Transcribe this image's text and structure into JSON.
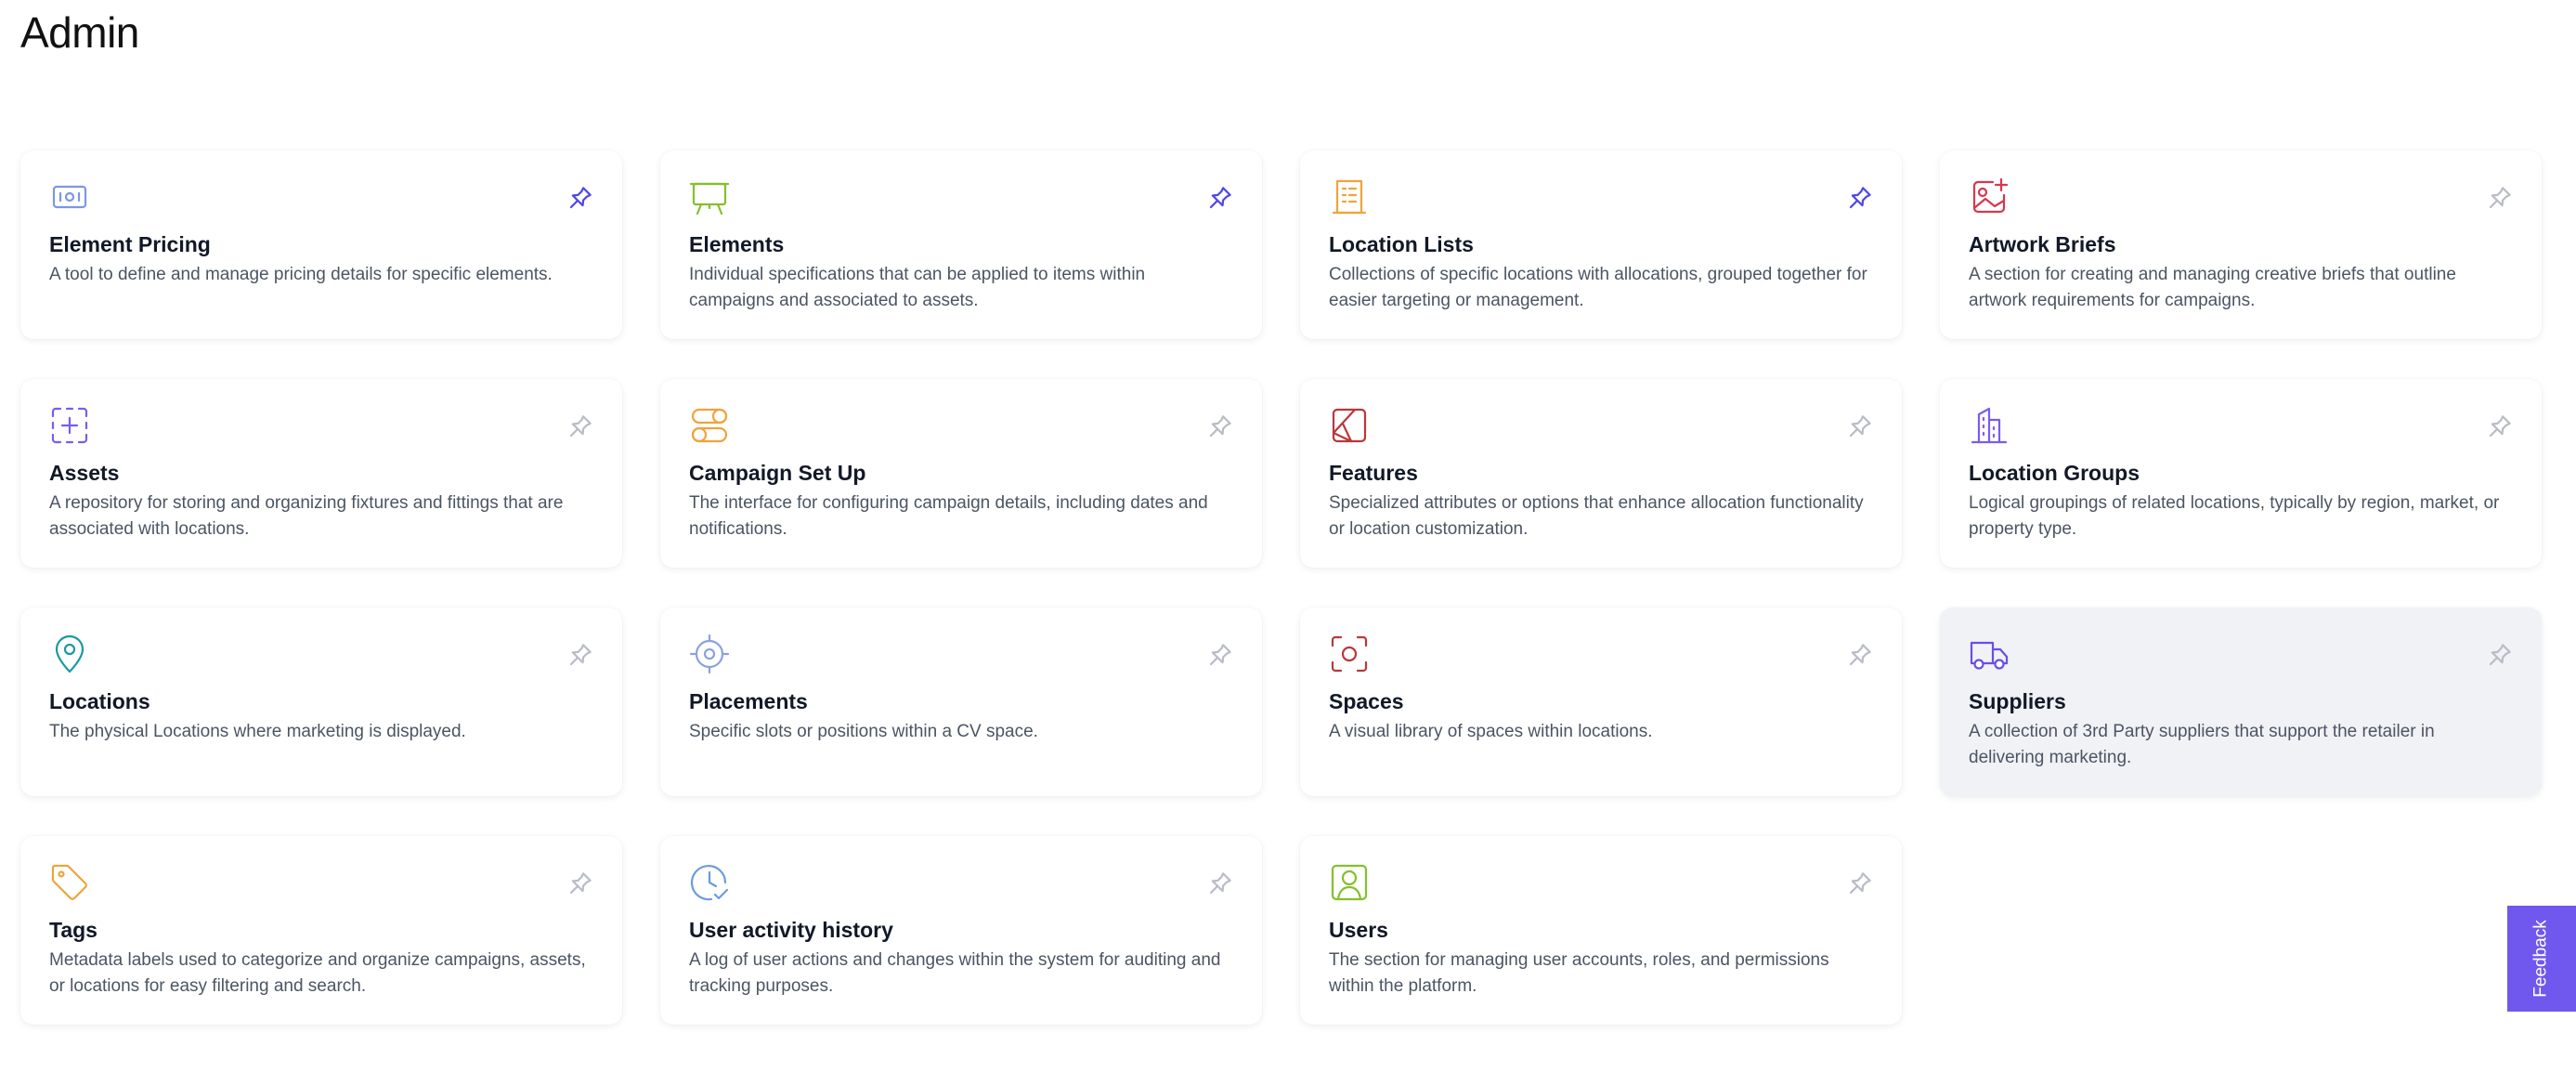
{
  "page": {
    "title": "Admin"
  },
  "colors": {
    "pin_active": "#4f46e5",
    "pin_inactive": "#b8bcc6",
    "hover_card": "#f1f2f6",
    "feedback_bg": "#7057ee"
  },
  "cards": [
    {
      "title": "Element Pricing",
      "description": "A tool to define and manage pricing details for specific elements.",
      "icon": "price-tag-card-icon",
      "icon_color": "#7c96e6",
      "pinned": true
    },
    {
      "title": "Elements",
      "description": "Individual specifications that can be applied to items within campaigns and associated to assets.",
      "icon": "presentation-board-icon",
      "icon_color": "#84c02b",
      "pinned": true
    },
    {
      "title": "Location Lists",
      "description": "Collections of specific locations with allocations, grouped together for easier targeting or management.",
      "icon": "list-document-icon",
      "icon_color": "#f0a33b",
      "pinned": true
    },
    {
      "title": "Artwork Briefs",
      "description": "A section for creating and managing creative briefs that outline artwork requirements for campaigns.",
      "icon": "image-add-icon",
      "icon_color": "#d9364f",
      "pinned": false
    },
    {
      "title": "Assets",
      "description": "A repository for storing and organizing fixtures and fittings that are associated with locations.",
      "icon": "dashed-square-plus-icon",
      "icon_color": "#7a5cf0",
      "pinned": false
    },
    {
      "title": "Campaign Set Up",
      "description": "The interface for configuring campaign details, including dates and notifications.",
      "icon": "toggles-icon",
      "icon_color": "#f0a33b",
      "pinned": false
    },
    {
      "title": "Features",
      "description": "Specialized attributes or options that enhance allocation functionality or location customization.",
      "icon": "feature-shape-icon",
      "icon_color": "#b8383b",
      "pinned": false
    },
    {
      "title": "Location Groups",
      "description": "Logical groupings of related locations, typically by region, market, or property type.",
      "icon": "buildings-icon",
      "icon_color": "#7a5cf0",
      "pinned": false
    },
    {
      "title": "Locations",
      "description": "The physical Locations where marketing is displayed.",
      "icon": "map-pin-icon",
      "icon_color": "#199aa3",
      "pinned": false
    },
    {
      "title": "Placements",
      "description": "Specific slots or positions within a CV space.",
      "icon": "crosshair-icon",
      "icon_color": "#8aa2e0",
      "pinned": false
    },
    {
      "title": "Spaces",
      "description": "A visual library of spaces within locations.",
      "icon": "focus-frame-icon",
      "icon_color": "#b8383b",
      "pinned": false
    },
    {
      "title": "Suppliers",
      "description": "A collection of 3rd Party suppliers that support the retailer in delivering marketing.",
      "icon": "truck-icon",
      "icon_color": "#6b4ee6",
      "pinned": false,
      "hovered": true
    },
    {
      "title": "Tags",
      "description": "Metadata labels used to categorize and organize campaigns, assets, or locations for easy filtering and search.",
      "icon": "tag-icon",
      "icon_color": "#f0a33b",
      "pinned": false
    },
    {
      "title": "User activity history",
      "description": "A log of user actions and changes within the system for auditing and tracking purposes.",
      "icon": "clock-check-icon",
      "icon_color": "#6a9be0",
      "pinned": false
    },
    {
      "title": "Users",
      "description": "The section for managing user accounts, roles, and permissions within the platform.",
      "icon": "user-square-icon",
      "icon_color": "#84c02b",
      "pinned": false
    }
  ],
  "feedback": {
    "label": "Feedback"
  }
}
